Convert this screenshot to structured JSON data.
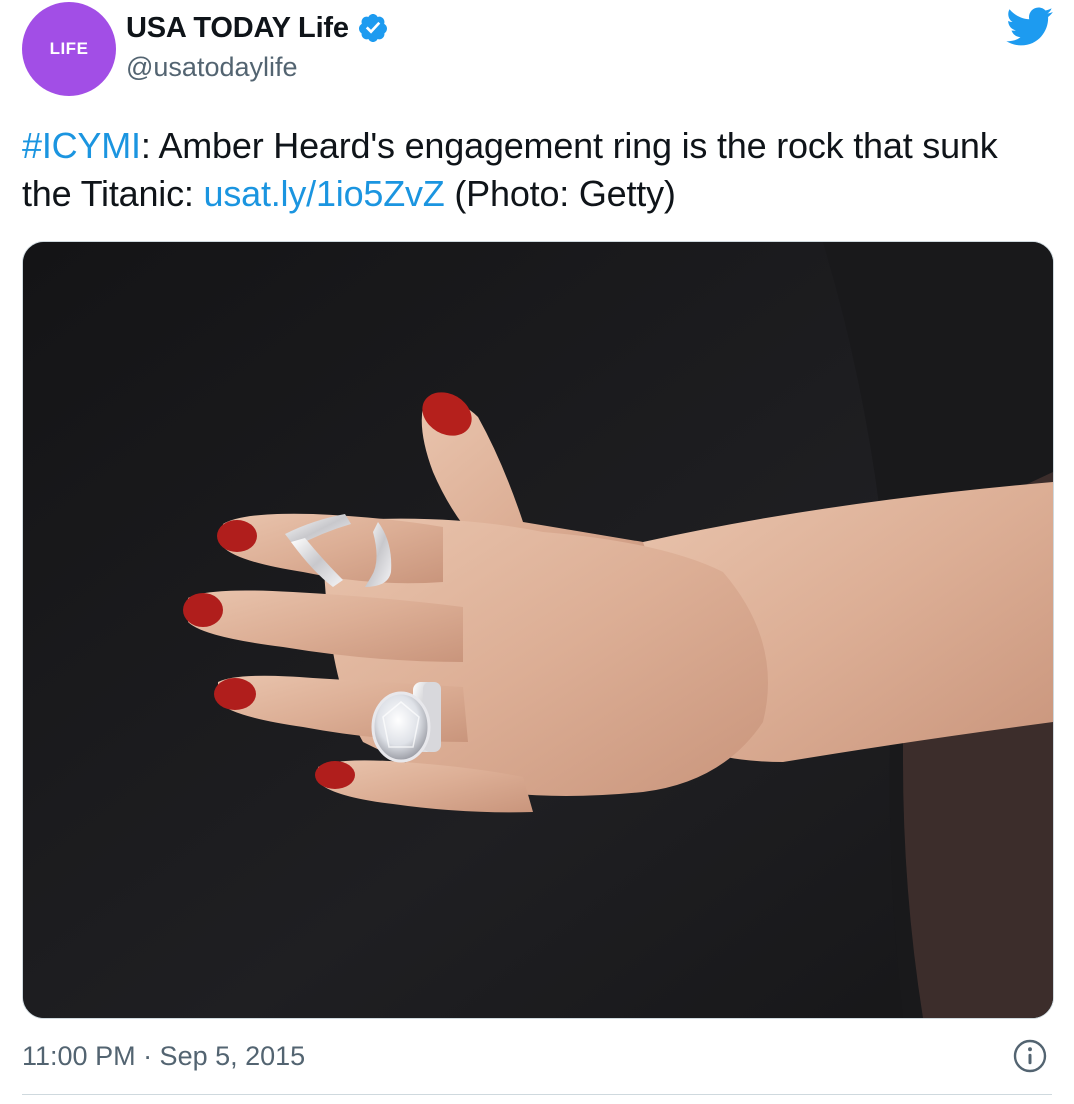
{
  "account": {
    "avatar_label": "LIFE",
    "display_name": "USA TODAY Life",
    "handle": "@usatodaylife",
    "verified_icon": "verified-badge-icon",
    "avatar_color": "#a24ee6"
  },
  "header": {
    "platform_icon": "twitter-bird-icon",
    "platform_color": "#1d9bf0"
  },
  "tweet": {
    "hashtag": "#ICYMI",
    "text_part1": ": Amber Heard's engagement ring is the rock that sunk the Titanic: ",
    "link": "usat.ly/1io5ZvZ",
    "text_part2": " (Photo: Getty)",
    "link_color": "#1b95e0"
  },
  "media": {
    "description_icon": "photo-hand-with-rings"
  },
  "footer": {
    "timestamp": "11:00 PM · Sep 5, 2015",
    "info_icon": "info-icon"
  }
}
